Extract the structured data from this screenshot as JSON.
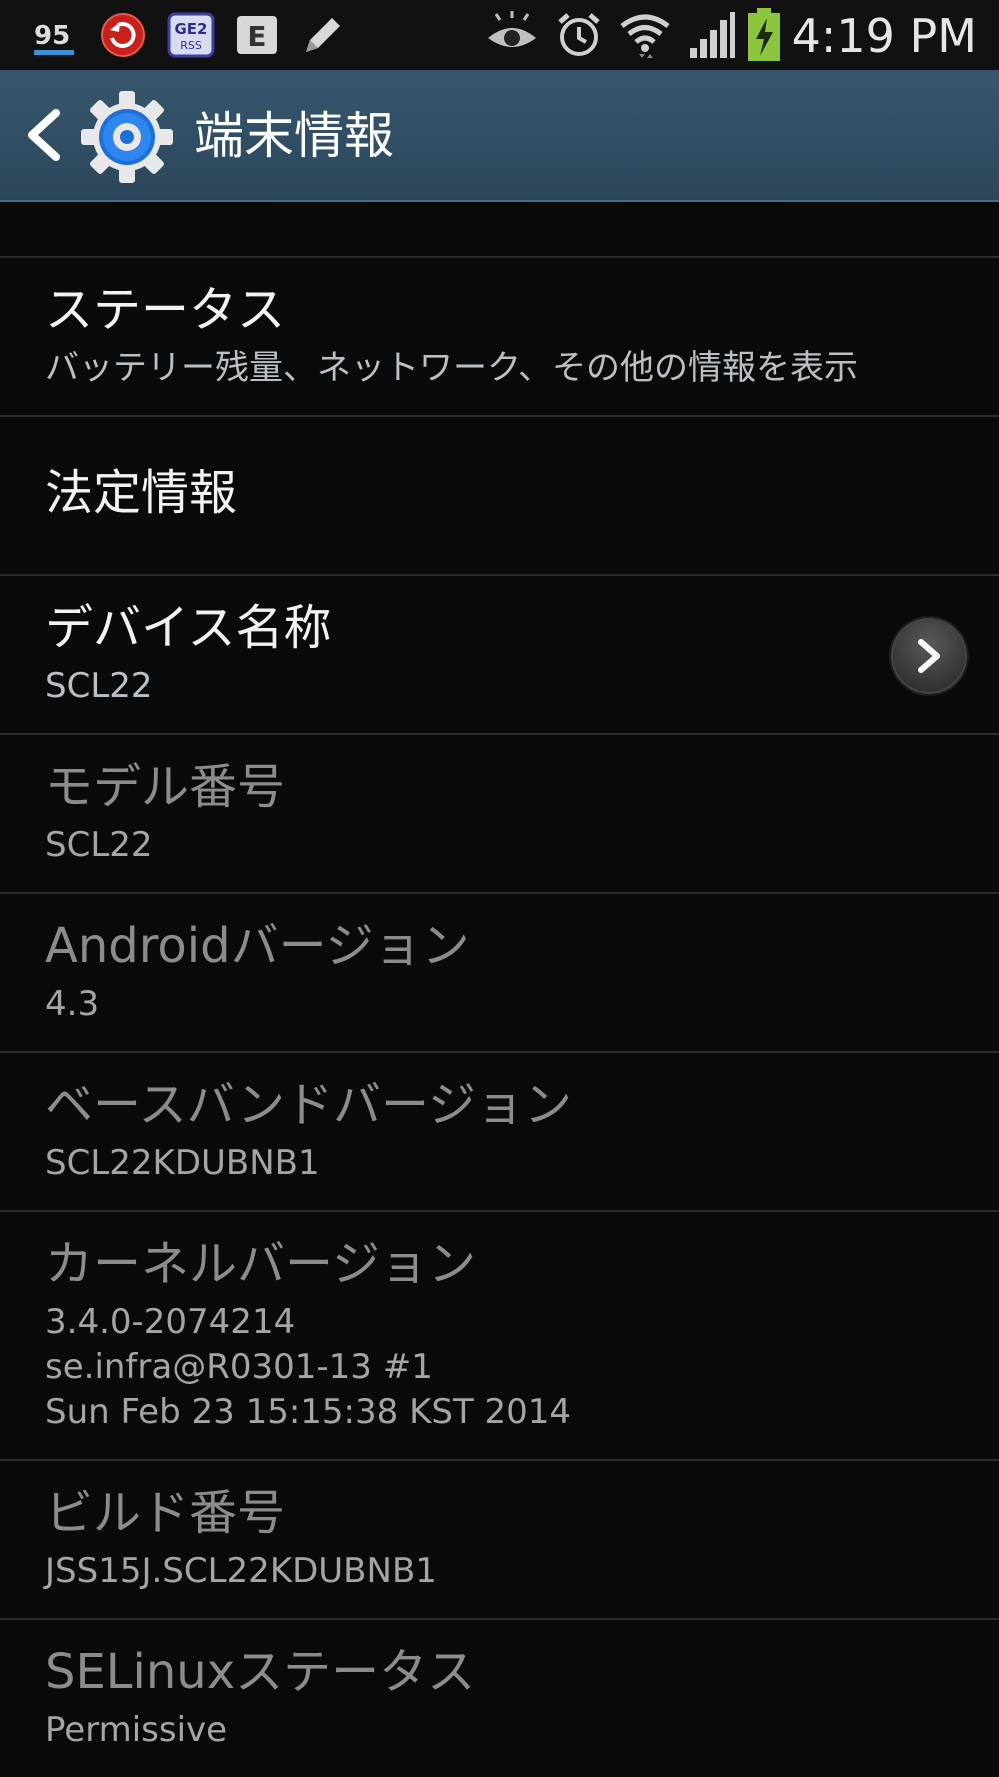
{
  "status_bar": {
    "time": "4:19 PM",
    "notification_icons": [
      "signal-strength-95-icon",
      "trend-micro-icon",
      "ge2-rss-icon",
      "e-app-icon",
      "pencil-icon"
    ],
    "notification_label_95": "95",
    "notification_label_ge2": "GE2",
    "notification_label_rss": "RSS",
    "notification_label_e": "E",
    "system_icons": [
      "smart-stay-eye-icon",
      "alarm-icon",
      "wifi-icon",
      "cell-signal-icon",
      "battery-charging-icon"
    ]
  },
  "action_bar": {
    "title": "端末情報",
    "back_icon": "back-chevron-icon",
    "app_icon": "settings-gear-icon"
  },
  "items": [
    {
      "title": "ステータス",
      "summary": "バッテリー残量、ネットワーク、その他の情報を表示",
      "enabled": true
    },
    {
      "title": "法定情報",
      "summary": "",
      "enabled": true
    },
    {
      "title": "デバイス名称",
      "summary": "SCL22",
      "enabled": true,
      "has_chevron": true
    },
    {
      "title": "モデル番号",
      "summary": "SCL22",
      "enabled": false
    },
    {
      "title": "Androidバージョン",
      "summary": "4.3",
      "enabled": false
    },
    {
      "title": "ベースバンドバージョン",
      "summary": "SCL22KDUBNB1",
      "enabled": false
    },
    {
      "title": "カーネルバージョン",
      "summary": "3.4.0-2074214\nse.infra@R0301-13 #1\nSun Feb 23 15:15:38 KST 2014",
      "enabled": false
    },
    {
      "title": "ビルド番号",
      "summary": "JSS15J.SCL22KDUBNB1",
      "enabled": false
    },
    {
      "title": "SELinuxステータス",
      "summary": "Permissive",
      "enabled": false
    }
  ],
  "colors": {
    "action_bar": "#2f4c62",
    "background": "#0a0a0a",
    "divider": "#2c2c2c",
    "battery": "#8cc63f",
    "settings_icon_blue": "#1e6fd9"
  }
}
